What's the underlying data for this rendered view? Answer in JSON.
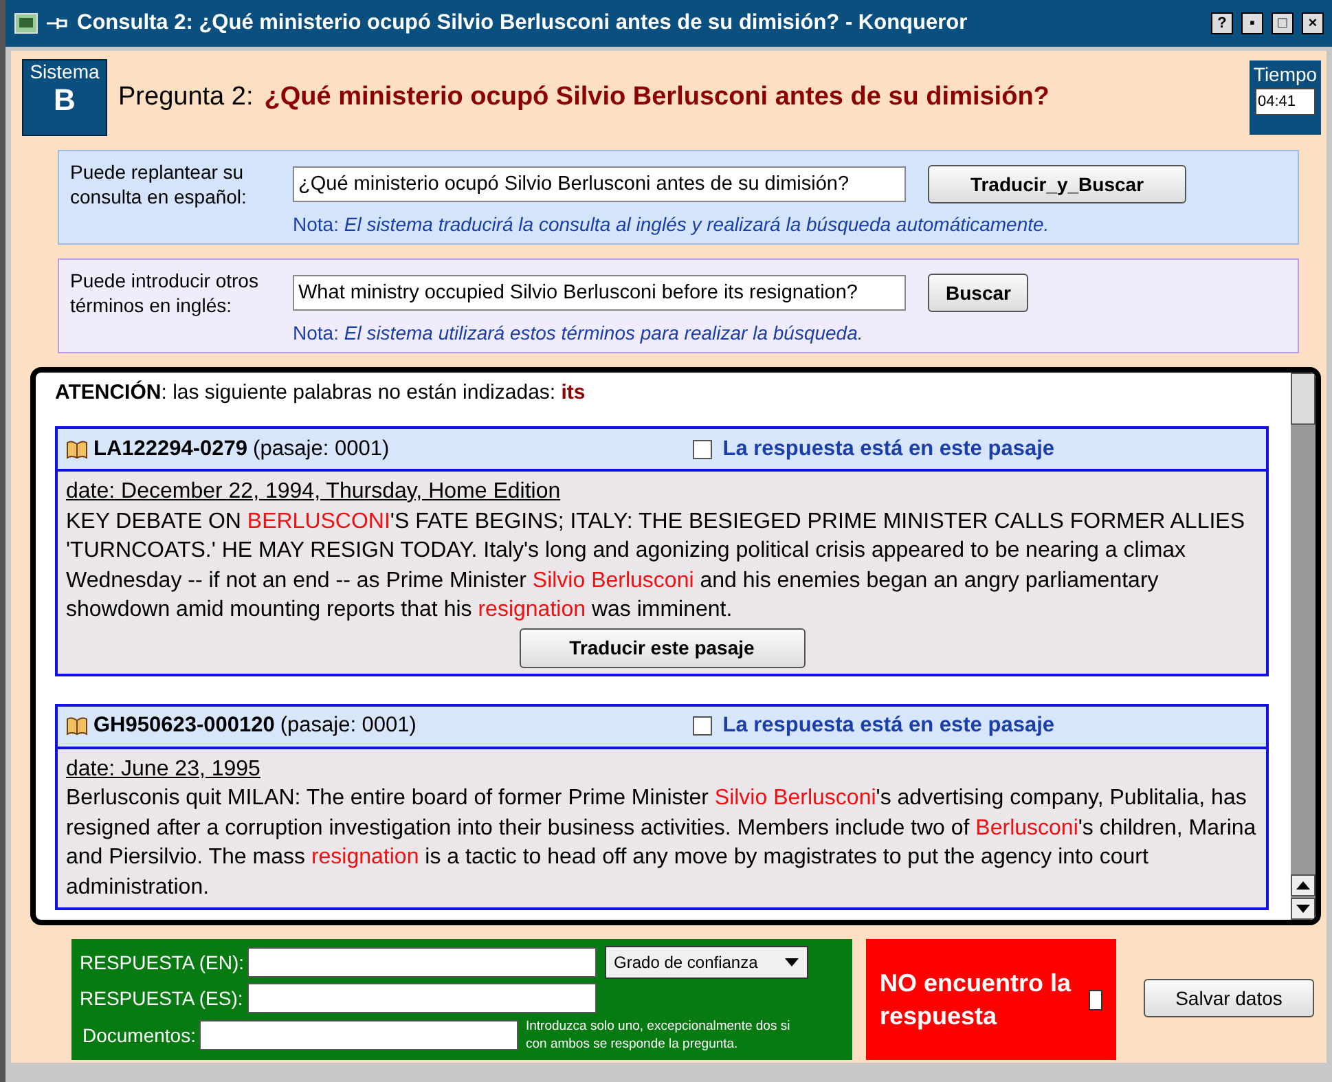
{
  "window": {
    "title": "Consulta 2: ¿Qué ministerio ocupó Silvio Berlusconi antes de su dimisión? - Konqueror",
    "buttons": [
      "?",
      "▪",
      "□",
      "×"
    ]
  },
  "header": {
    "system_label": "Sistema",
    "system": "B",
    "question_label": "Pregunta 2:",
    "question": "¿Qué ministerio ocupó Silvio Berlusconi antes de su dimisión?",
    "time_label": "Tiempo",
    "time": "04:41"
  },
  "spanish_query": {
    "label": "Puede replantear su consulta en español:",
    "value": "¿Qué ministerio ocupó Silvio Berlusconi antes de su dimisión?",
    "button": "Traducir_y_Buscar",
    "note_label": "Nota:",
    "note": "El sistema traducirá la consulta al inglés y realizará la búsqueda automáticamente."
  },
  "english_query": {
    "label": "Puede introducir otros términos en inglés:",
    "value": "What ministry occupied Silvio Berlusconi before its resignation?",
    "button": "Buscar",
    "note_label": "Nota:",
    "note": "El sistema utilizará estos términos para realizar la búsqueda."
  },
  "results": {
    "warning_label": "ATENCIÓN",
    "warning": ": las siguiente palabras no están indizadas: ",
    "unindexed": "its",
    "passages": [
      {
        "doc_id": "LA122294-0279",
        "passage": "(pasaje: 0001)",
        "checked": false,
        "check_label": "La respuesta está en este pasaje",
        "date": "date: December 22, 1994, Thursday, Home Edition",
        "segments": [
          {
            "text": "KEY DEBATE ON ",
            "highlight": false
          },
          {
            "text": "BERLUSCONI",
            "highlight": true
          },
          {
            "text": "'S FATE BEGINS; ITALY: THE BESIEGED PRIME MINISTER CALLS FORMER ALLIES 'TURNCOATS.' HE MAY RESIGN TODAY. Italy's long and agonizing political crisis appeared to be nearing a climax Wednesday -- if not an end -- as Prime Minister ",
            "highlight": false
          },
          {
            "text": "Silvio Berlusconi",
            "highlight": true
          },
          {
            "text": " and his enemies began an angry parliamentary showdown amid mounting reports that his ",
            "highlight": false
          },
          {
            "text": "resignation",
            "highlight": true
          },
          {
            "text": " was imminent.",
            "highlight": false
          }
        ],
        "button": "Traducir este pasaje"
      },
      {
        "doc_id": "GH950623-000120",
        "passage": "(pasaje: 0001)",
        "checked": false,
        "check_label": "La respuesta está en este pasaje",
        "date": "date: June 23, 1995",
        "segments": [
          {
            "text": "Berlusconis quit MILAN: The entire board of former Prime Minister ",
            "highlight": false
          },
          {
            "text": "Silvio Berlusconi",
            "highlight": true
          },
          {
            "text": "'s advertising company, Publitalia, has resigned after a corruption investigation into their business activities. Members include two of ",
            "highlight": false
          },
          {
            "text": "Berlusconi",
            "highlight": true
          },
          {
            "text": "'s children, Marina and Piersilvio. The mass ",
            "highlight": false
          },
          {
            "text": "resignation",
            "highlight": true
          },
          {
            "text": " is a tactic to head off any move by magistrates to put the agency into court administration.",
            "highlight": false
          }
        ]
      }
    ]
  },
  "answer": {
    "en_label": "RESPUESTA (EN):",
    "es_label": "RESPUESTA (ES):",
    "docs_label": "Documentos:",
    "confidence": "Grado de confianza",
    "hint": "Introduzca solo uno, excepcionalmente dos si con ambos se responde la pregunta.",
    "not_found": "NO encuentro la respuesta",
    "not_found_checked": false,
    "save": "Salvar datos"
  }
}
